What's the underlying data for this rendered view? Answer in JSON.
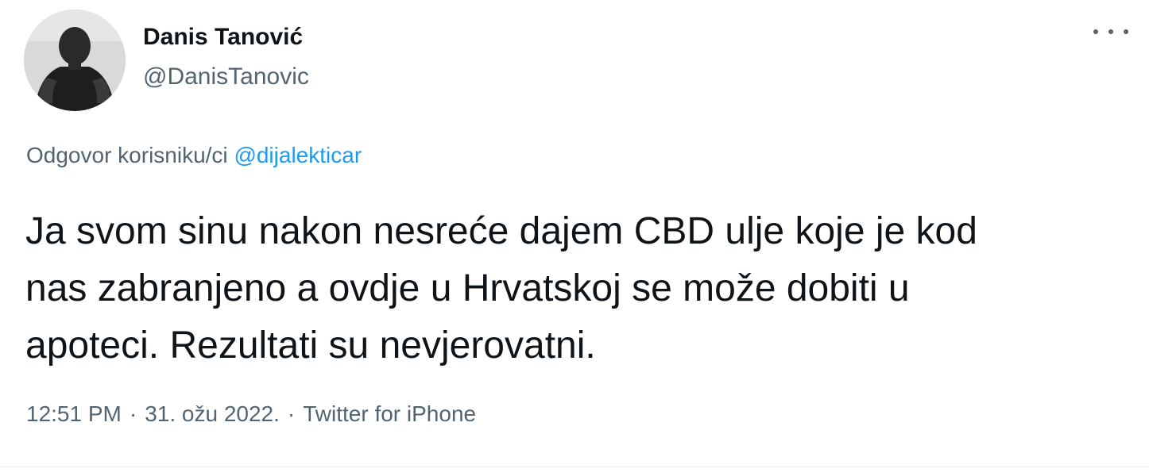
{
  "author": {
    "display_name": "Danis Tanović",
    "handle": "@DanisTanovic"
  },
  "more_icon": "more-horizontal-icon",
  "reply": {
    "prefix": "Odgovor korisniku/ci",
    "target": "@dijalekticar"
  },
  "tweet": {
    "lines": [
      "Ja svom sinu nakon nesreće dajem CBD ulje koje je kod",
      "nas zabranjeno a ovdje u Hrvatskoj se može dobiti u",
      "apoteci. Rezultati su nevjerovatni."
    ]
  },
  "meta": {
    "time": "12:51 PM",
    "date": "31. ožu 2022.",
    "source": "Twitter for iPhone",
    "separator": "·"
  },
  "colors": {
    "text": "#0f1419",
    "secondary": "#536471",
    "link": "#1d9bf0"
  }
}
